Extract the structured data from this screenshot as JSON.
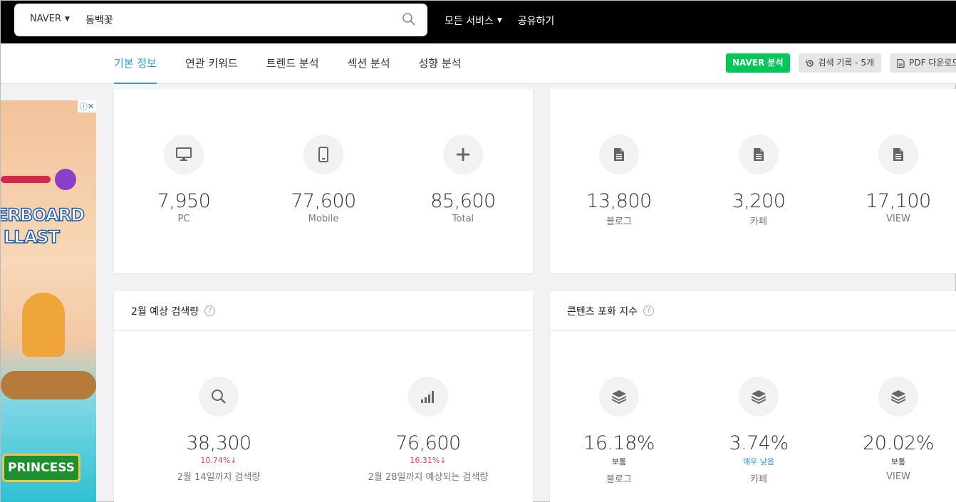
{
  "search": {
    "engine": "NAVER",
    "query": "동백꽃"
  },
  "topnav": {
    "all_services": "모든 서비스",
    "share": "공유하기"
  },
  "tabs": [
    "기본 정보",
    "연관 키워드",
    "트렌드 분석",
    "섹션 분석",
    "성향 분석"
  ],
  "actions": {
    "naver_analysis": "NAVER 분석",
    "search_history": "검색 기록 - 5개",
    "pdf_download": "PDF 다운로드"
  },
  "ad": {
    "text1": "ERBOARD",
    "text2": "LLAST",
    "button": "PRINCESS",
    "close": "ⓘ✕"
  },
  "search_volume": {
    "items": [
      {
        "value": "7,950",
        "label": "PC"
      },
      {
        "value": "77,600",
        "label": "Mobile"
      },
      {
        "value": "85,600",
        "label": "Total"
      }
    ]
  },
  "content_count": {
    "items": [
      {
        "value": "13,800",
        "label": "블로그"
      },
      {
        "value": "3,200",
        "label": "카페"
      },
      {
        "value": "17,100",
        "label": "VIEW"
      }
    ]
  },
  "forecast": {
    "title": "2월 예상 검색량",
    "items": [
      {
        "value": "38,300",
        "change": "10.74%↓",
        "label": "2월 14일까지 검색량"
      },
      {
        "value": "76,600",
        "change": "16.31%↓",
        "label": "2월 28일까지 예상되는 검색량"
      }
    ]
  },
  "saturation": {
    "title": "콘텐츠 포화 지수",
    "items": [
      {
        "value": "16.18%",
        "level": "보통",
        "label": "블로그"
      },
      {
        "value": "3.74%",
        "level": "매우 낮음",
        "label": "카페"
      },
      {
        "value": "20.02%",
        "level": "보통",
        "label": "VIEW"
      }
    ]
  },
  "colors": {
    "accent": "#2e9bd6",
    "naver_green": "#03c75a",
    "down_red": "#e5484d"
  }
}
